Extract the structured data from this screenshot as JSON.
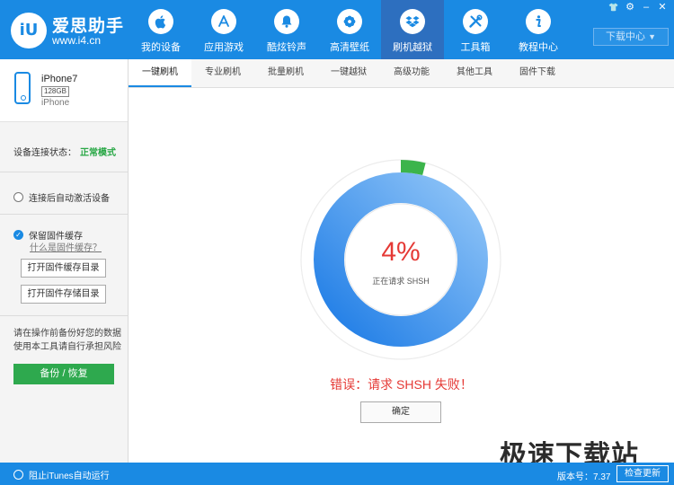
{
  "app": {
    "badge": "iU",
    "title": "爱思助手",
    "url": "www.i4.cn"
  },
  "nav": {
    "items": [
      {
        "label": "我的设备"
      },
      {
        "label": "应用游戏"
      },
      {
        "label": "酷炫铃声"
      },
      {
        "label": "高清壁纸"
      },
      {
        "label": "刷机越狱"
      },
      {
        "label": "工具箱"
      },
      {
        "label": "教程中心"
      }
    ],
    "active_index": 4
  },
  "download_center": {
    "label": "下载中心",
    "caret": "▼"
  },
  "window_controls": {
    "shirt": "👕",
    "settings": "⚙",
    "minimize": "–",
    "close": "✕"
  },
  "device": {
    "name": "iPhone7",
    "capacity": "128GB",
    "type": "iPhone"
  },
  "connection": {
    "label": "设备连接状态：",
    "value": "正常模式"
  },
  "sidebar": {
    "auto_activate": "连接后自动激活设备",
    "keep_firmware": "保留固件缓存",
    "what_is_cache": "什么是固件缓存？",
    "open_cache_dir": "打开固件缓存目录",
    "open_storage_dir": "打开固件存储目录",
    "warning": "请在操作前备份好您的数据使用本工具请自行承担风险",
    "backup_button": "备份 / 恢复"
  },
  "tabs": [
    {
      "label": "一键刷机"
    },
    {
      "label": "专业刷机"
    },
    {
      "label": "批量刷机"
    },
    {
      "label": "一键越狱"
    },
    {
      "label": "高级功能"
    },
    {
      "label": "其他工具"
    },
    {
      "label": "固件下载"
    }
  ],
  "progress": {
    "value": 0.04,
    "percent_text": "4%",
    "status": "正在请求 SHSH"
  },
  "error": {
    "message": "错误：请求 SHSH 失败！",
    "ok_button": "确定"
  },
  "watermark": "极速下载站",
  "footer": {
    "block_itunes": "阻止iTunes自动运行",
    "version": "版本号：7.37",
    "check_update": "检查更新"
  },
  "colors": {
    "brand_blue": "#1a8ae3",
    "success_green": "#28a745",
    "error_red": "#e53935",
    "progress_green": "#3cb44b"
  }
}
